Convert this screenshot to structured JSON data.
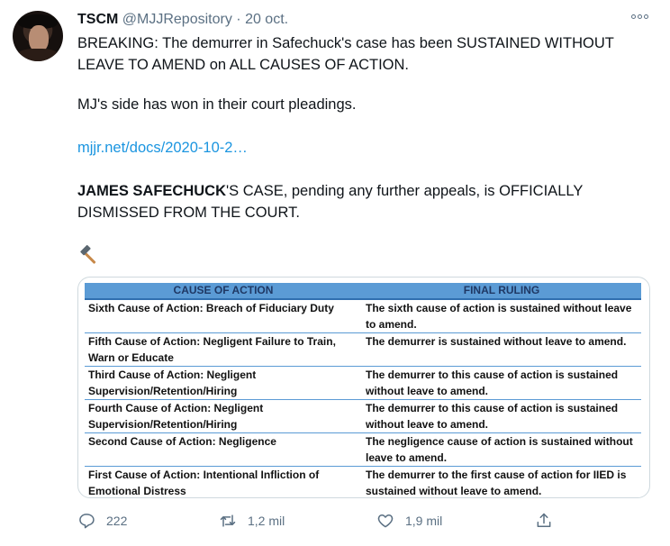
{
  "tweet": {
    "display_name": "TSCM",
    "handle": "@MJJRepository",
    "separator": "·",
    "date": "20 oct.",
    "paragraph1": "BREAKING: The demurrer in Safechuck's case has been SUSTAINED WITHOUT LEAVE TO AMEND on ALL CAUSES OF ACTION.",
    "paragraph2": "MJ's side has won in their court pleadings.",
    "link_text": "mjjr.net/docs/2020-10-2…",
    "paragraph4_bold": "JAMES SAFECHUCK",
    "paragraph4_rest": "'S CASE, pending any further appeals, is OFFICIALLY DISMISSED FROM THE COURT.",
    "emoji": "hammer-icon"
  },
  "table": {
    "headers": [
      "CAUSE OF ACTION",
      "FINAL RULING"
    ],
    "rows": [
      {
        "cause": "Sixth Cause of Action: Breach of Fiduciary Duty",
        "ruling": "The sixth cause of action is sustained without leave to amend."
      },
      {
        "cause": "Fifth Cause of Action: Negligent Failure to Train, Warn or Educate",
        "ruling": "The demurrer is sustained without leave to amend."
      },
      {
        "cause": "Third Cause of Action: Negligent Supervision/Retention/Hiring",
        "ruling": "The demurrer to this cause of action is sustained without leave to amend."
      },
      {
        "cause": "Fourth Cause of Action: Negligent Supervision/Retention/Hiring",
        "ruling": "The demurrer to this cause of action is sustained without leave to amend."
      },
      {
        "cause": "Second Cause of Action: Negligence",
        "ruling": "The negligence cause of action is sustained without leave to amend."
      },
      {
        "cause": "First Cause of Action: Intentional Infliction of Emotional Distress",
        "ruling": "The demurrer to the first cause of action for IIED is sustained without leave to amend."
      }
    ]
  },
  "actions": {
    "reply_count": "222",
    "retweet_count": "1,2 mil",
    "like_count": "1,9 mil"
  },
  "colors": {
    "link": "#1b95e0",
    "muted": "#5b7083",
    "table_header": "#5b9bd5"
  }
}
